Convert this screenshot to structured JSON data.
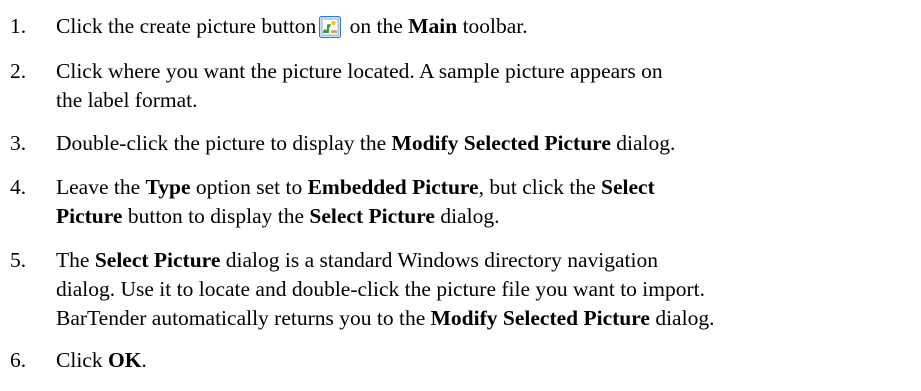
{
  "steps": [
    {
      "number": "1.",
      "parts": {
        "a": "Click the create picture button",
        "b": "on the",
        "c": "Main",
        "d": "toolbar."
      }
    },
    {
      "number": "2.",
      "parts": {
        "a": "Click where you want the picture located. A sample picture appears on",
        "b": "the label format."
      }
    },
    {
      "number": "3.",
      "parts": {
        "a": "Double-click the picture to display the",
        "b": "Modify Selected Picture",
        "c": "dialog."
      }
    },
    {
      "number": "4.",
      "parts": {
        "a": "Leave the",
        "b": "Type",
        "c": "option set to",
        "d": "Embedded Picture",
        "e": ", but click the",
        "f": "Select",
        "g": "Picture",
        "h": "button to display the",
        "i": "Select Picture",
        "j": "dialog."
      }
    },
    {
      "number": "5.",
      "parts": {
        "a": "The",
        "b": "Select Picture",
        "c": "dialog is a standard Windows directory navigation",
        "d": "dialog. Use it to locate and double-click the picture file you want to import.",
        "e": "BarTender automatically returns you to the",
        "f": "Modify Selected Picture",
        "g": "dialog."
      }
    },
    {
      "number": "6.",
      "parts": {
        "a": "Click",
        "b": "OK",
        "c": "."
      }
    }
  ],
  "icons": {
    "create_picture": "create-picture-icon"
  }
}
